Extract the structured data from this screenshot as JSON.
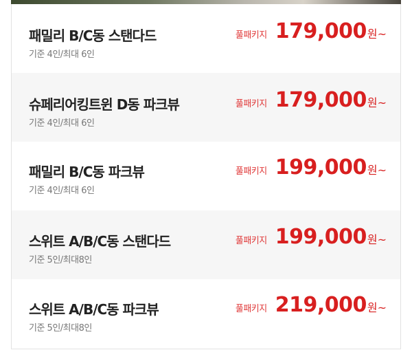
{
  "rooms": [
    {
      "name": "패밀리 B/C동 스탠다드",
      "capacity": "기준 4인/최대 6인",
      "package_label": "풀패키지",
      "price": "179,000",
      "unit": "원~"
    },
    {
      "name": "슈페리어킹트윈 D동 파크뷰",
      "capacity": "기준 4인/최대 6인",
      "package_label": "풀패키지",
      "price": "179,000",
      "unit": "원~"
    },
    {
      "name": "패밀리 B/C동 파크뷰",
      "capacity": "기준 4인/최대 6인",
      "package_label": "풀패키지",
      "price": "199,000",
      "unit": "원~"
    },
    {
      "name": "스위트 A/B/C동 스탠다드",
      "capacity": "기준 5인/최대8인",
      "package_label": "풀패키지",
      "price": "199,000",
      "unit": "원~"
    },
    {
      "name": "스위트 A/B/C동 파크뷰",
      "capacity": "기준 5인/최대8인",
      "package_label": "풀패키지",
      "price": "219,000",
      "unit": "원~"
    }
  ],
  "colors": {
    "price": "#d81f1f",
    "package_label": "#e03a3a",
    "alt_row_bg": "#f6f6f6"
  }
}
